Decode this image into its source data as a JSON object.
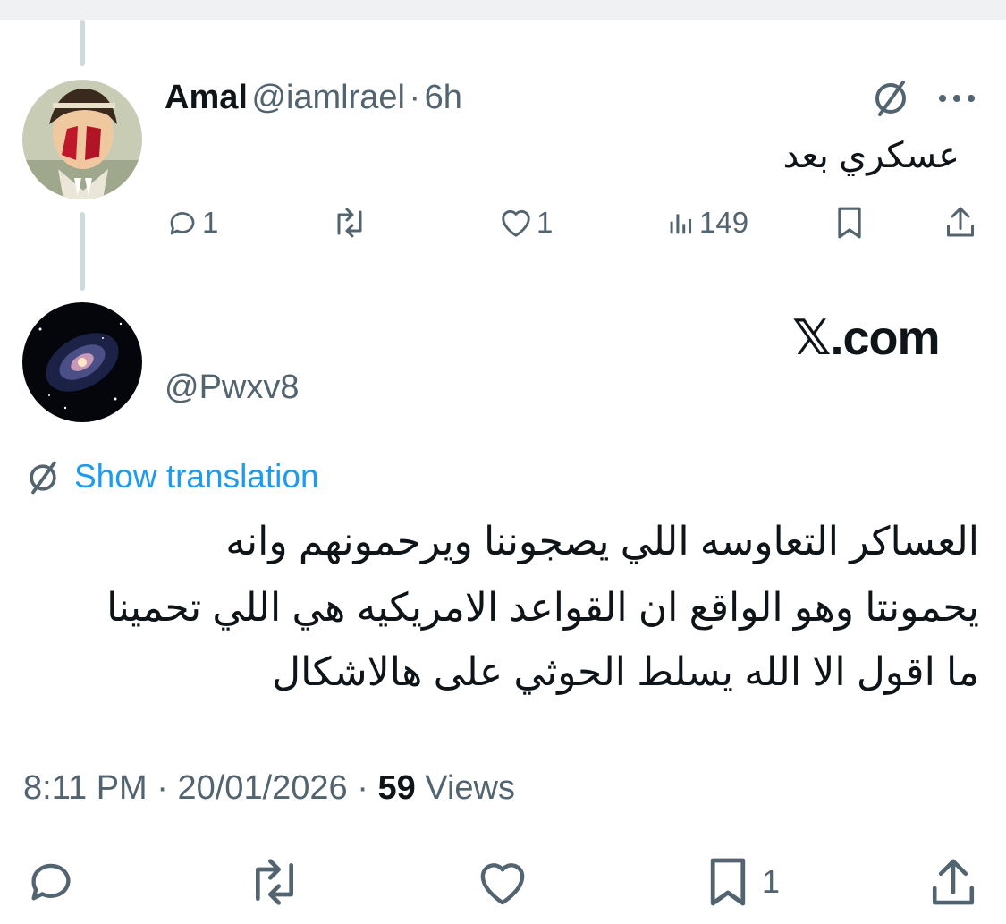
{
  "reply_tweet": {
    "author_name": "Amal",
    "author_handle": "@iamlrael",
    "separator": "·",
    "time": "6h",
    "text": "عسكري بعد",
    "actions": {
      "replies": "1",
      "reposts": "",
      "likes": "1",
      "views": "149"
    }
  },
  "main_tweet": {
    "author_handle": "@Pwxv8",
    "watermark": "𝕏.com",
    "show_translation_label": "Show translation",
    "lines": [
      "العساكر التعاوسه اللي يصجوننا ويرحمونهم وانه",
      "يحمونتا وهو الواقع ان القواعد الامريكيه هي اللي تحمينا",
      "ما اقول الا الله يسلط الحوثي على هالاشكال"
    ],
    "time": "8:11 PM",
    "separator": "·",
    "date": "20/01/2026",
    "views_count": "59",
    "views_label": "Views",
    "bookmarks": "1"
  },
  "colors": {
    "text": "#0f1419",
    "secondary": "#536471",
    "link": "#1d9bf0",
    "thread_line": "#cfd9de"
  }
}
